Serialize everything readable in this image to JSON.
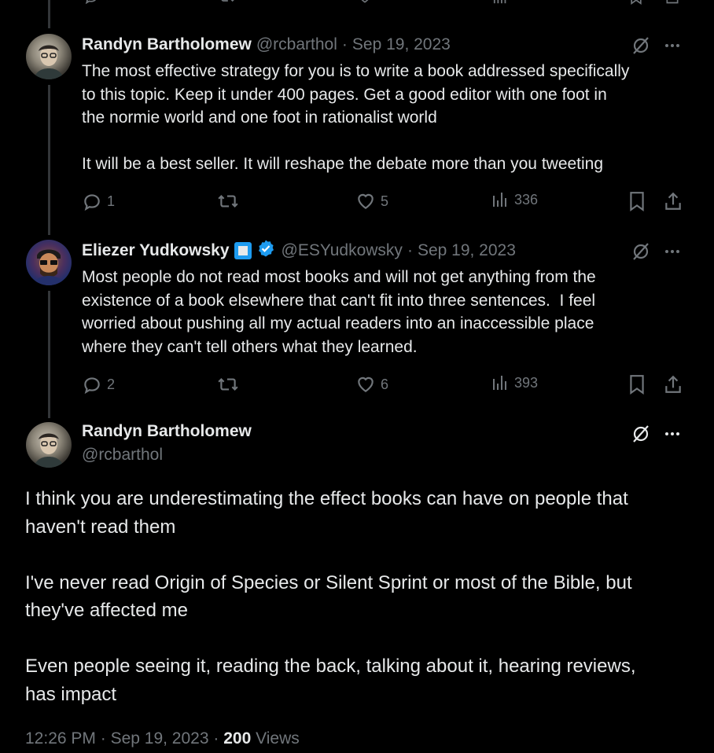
{
  "tweets": [
    {
      "name": "Randyn Bartholomew",
      "handle": "@rcbarthol",
      "separator": "·",
      "date": "Sep 19, 2023",
      "text": "The most effective strategy for you is to write a book addressed specifically\nto this topic. Keep it under 400 pages. Get a good editor with one foot in\nthe normie world and one foot in rationalist world\n\nIt will be a best seller. It will reshape the debate more than you tweeting",
      "replies": "1",
      "reposts": "",
      "likes": "5",
      "views": "336"
    },
    {
      "name": "Eliezer Yudkowsky",
      "handle": "@ESYudkowsky",
      "separator": "·",
      "date": "Sep 19, 2023",
      "text": "Most people do not read most books and will not get anything from the\nexistence of a book elsewhere that can't fit into three sentences.  I feel\nworried about pushing all my actual readers into an inaccessible place\nwhere they can't tell others what they learned.",
      "replies": "2",
      "reposts": "",
      "likes": "6",
      "views": "393"
    }
  ],
  "main_tweet": {
    "name": "Randyn Bartholomew",
    "handle": "@rcbarthol",
    "text": "I think you are underestimating the effect books can have on people that\nhaven't read them\n\nI've never read Origin of Species or Silent Sprint or most of the Bible, but\nthey've affected me\n\nEven people seeing it, reading the back, talking about it, hearing reviews,\nhas impact",
    "time": "12:26 PM",
    "separator": "·",
    "date": "Sep 19, 2023",
    "views_count": "200",
    "views_label": "Views"
  },
  "icons": {
    "reply": "reply-icon",
    "repost": "repost-icon",
    "like": "heart-icon",
    "views": "analytics-icon",
    "bookmark": "bookmark-icon",
    "share": "share-icon",
    "grok": "grok-icon",
    "more": "more-icon",
    "verified": "verified-badge-icon",
    "affiliate": "affiliate-badge-icon"
  },
  "colors": {
    "background": "#000000",
    "text": "#e7e9ea",
    "muted": "#71767b",
    "accent": "#1d9bf0",
    "thread_line": "#333639"
  }
}
